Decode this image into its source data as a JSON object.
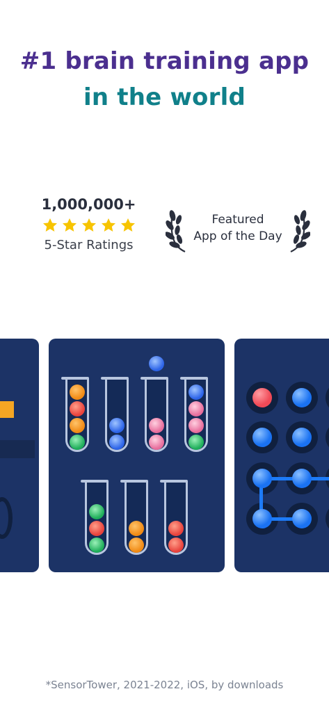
{
  "headline": {
    "line1": "#1 brain training app",
    "line2": "in the world",
    "line1_color": "#4b2f8f",
    "line2_color": "#10808a"
  },
  "ratings": {
    "count": "1,000,000+",
    "stars": 5,
    "label": "5-Star Ratings",
    "star_color": "#f7c400"
  },
  "featured": {
    "line1": "Featured",
    "line2": "App of the Day",
    "icon": "laurel-wreath-icon"
  },
  "screens": {
    "background_color": "#1c3366",
    "center_puzzle": "ball-sort",
    "right_puzzle": "connect-dots"
  },
  "footnote": "*SensorTower, 2021-2022, iOS, by downloads"
}
